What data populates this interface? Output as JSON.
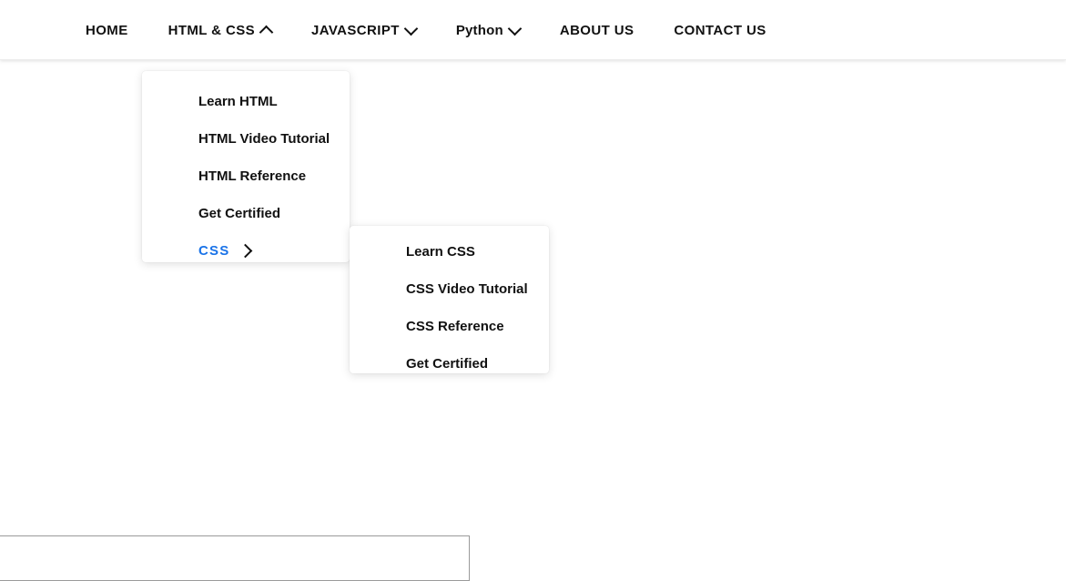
{
  "navbar": {
    "items": [
      {
        "label": "HOME",
        "caret": "none",
        "uppercase": true
      },
      {
        "label": "HTML & CSS",
        "caret": "up",
        "uppercase": true
      },
      {
        "label": "JAVASCRIPT",
        "caret": "down",
        "uppercase": true
      },
      {
        "label": "Python",
        "caret": "down",
        "uppercase": false
      },
      {
        "label": "ABOUT US",
        "caret": "none",
        "uppercase": true
      },
      {
        "label": "CONTACT US",
        "caret": "none",
        "uppercase": true
      }
    ]
  },
  "dropdown_html_css": {
    "items": [
      {
        "label": "Learn HTML",
        "caret": "none",
        "active": false
      },
      {
        "label": "HTML Video Tutorial",
        "caret": "none",
        "active": false
      },
      {
        "label": "HTML Reference",
        "caret": "none",
        "active": false
      },
      {
        "label": "Get Certified",
        "caret": "none",
        "active": false
      },
      {
        "label": "CSS",
        "caret": "right",
        "active": true
      }
    ]
  },
  "dropdown_css": {
    "items": [
      {
        "label": "Learn CSS",
        "caret": "none",
        "active": false
      },
      {
        "label": "CSS Video Tutorial",
        "caret": "none",
        "active": false
      },
      {
        "label": "CSS Reference",
        "caret": "none",
        "active": false
      },
      {
        "label": "Get Certified",
        "caret": "none",
        "active": false
      }
    ]
  },
  "colors": {
    "page_background": "#ffffff",
    "nav_text": "#111111",
    "active_item": "#1a73e8",
    "panel_background": "#ffffff",
    "bottom_box_border": "#9a9a9a"
  }
}
